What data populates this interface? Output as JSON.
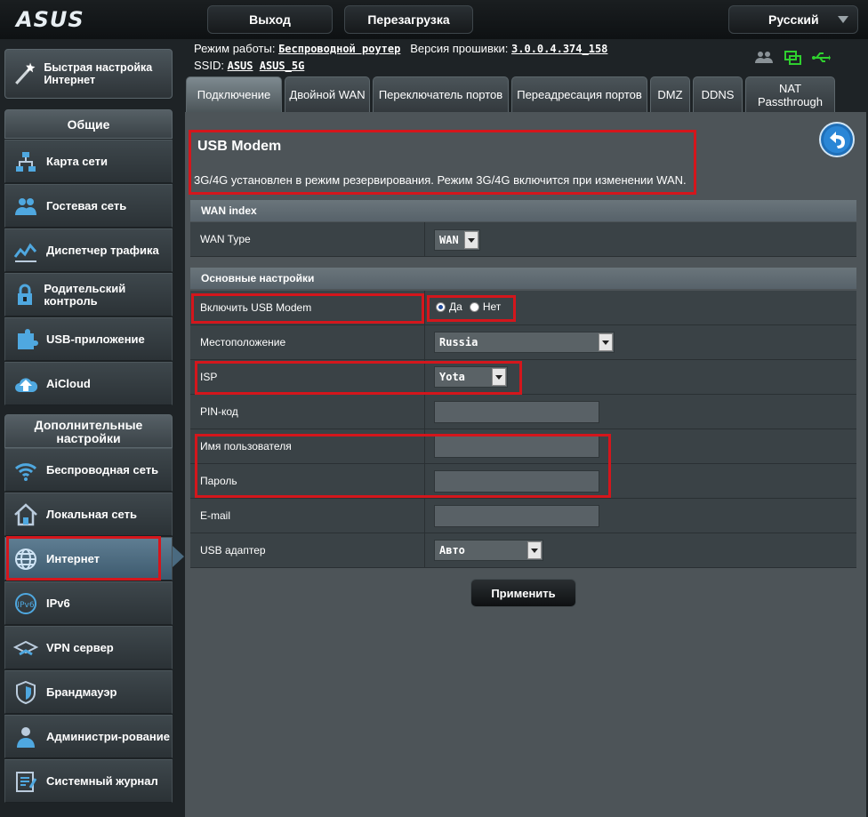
{
  "brand": "ASUS",
  "top": {
    "logout": "Выход",
    "reboot": "Перезагрузка",
    "language": "Русский"
  },
  "info": {
    "mode_label": "Режим работы:",
    "mode_value": "Беспроводной роутер",
    "fw_label": "Версия прошивки:",
    "fw_value": "3.0.0.4.374_158",
    "ssid_label": "SSID:",
    "ssid_1": "ASUS",
    "ssid_2": "ASUS_5G"
  },
  "sidebar": {
    "quick": "Быстрая настройка Интернет",
    "general_head": "Общие",
    "general_items": [
      {
        "label": "Карта сети",
        "icon": "network-map-icon"
      },
      {
        "label": "Гостевая сеть",
        "icon": "guest-network-icon"
      },
      {
        "label": "Диспетчер трафика",
        "icon": "traffic-manager-icon"
      },
      {
        "label": "Родительский контроль",
        "icon": "parental-control-icon"
      },
      {
        "label": "USB-приложение",
        "icon": "usb-app-icon"
      },
      {
        "label": "AiCloud",
        "icon": "aicloud-icon"
      }
    ],
    "advanced_head": "Дополнительные настройки",
    "advanced_items": [
      {
        "label": "Беспроводная сеть",
        "icon": "wireless-icon"
      },
      {
        "label": "Локальная сеть",
        "icon": "lan-icon"
      },
      {
        "label": "Интернет",
        "icon": "internet-icon",
        "active": true
      },
      {
        "label": "IPv6",
        "icon": "ipv6-icon"
      },
      {
        "label": "VPN сервер",
        "icon": "vpn-icon"
      },
      {
        "label": "Брандмауэр",
        "icon": "firewall-icon"
      },
      {
        "label": "Администри-рование",
        "icon": "admin-icon"
      },
      {
        "label": "Системный журнал",
        "icon": "syslog-icon"
      }
    ]
  },
  "tabs": [
    {
      "label": "Подключение",
      "active": true
    },
    {
      "label": "Двойной WAN"
    },
    {
      "label": "Переключатель портов"
    },
    {
      "label": "Переадресация портов"
    },
    {
      "label": "DMZ"
    },
    {
      "label": "DDNS"
    },
    {
      "label": "NAT Passthrough"
    }
  ],
  "main": {
    "title": "USB Modem",
    "subtitle": "3G/4G установлен в режим резервирования. Режим 3G/4G включится при изменении WAN.",
    "wan_index_head": "WAN index",
    "wan_type_label": "WAN Type",
    "wan_type_value": "WAN",
    "basic_head": "Основные настройки",
    "enable_label": "Включить USB Modem",
    "yes": "Да",
    "no": "Нет",
    "enable_value": "Да",
    "location_label": "Местоположение",
    "location_value": "Russia",
    "isp_label": "ISP",
    "isp_value": "Yota",
    "pin_label": "PIN-код",
    "pin_value": "",
    "username_label": "Имя пользователя",
    "username_value": "",
    "password_label": "Пароль",
    "password_value": "",
    "email_label": "E-mail",
    "email_value": "",
    "adapter_label": "USB адаптер",
    "adapter_value": "Авто",
    "apply": "Применить"
  },
  "colors": {
    "highlight": "#d4161c",
    "panel": "#4d5458",
    "active_item": "#4a6a80"
  }
}
